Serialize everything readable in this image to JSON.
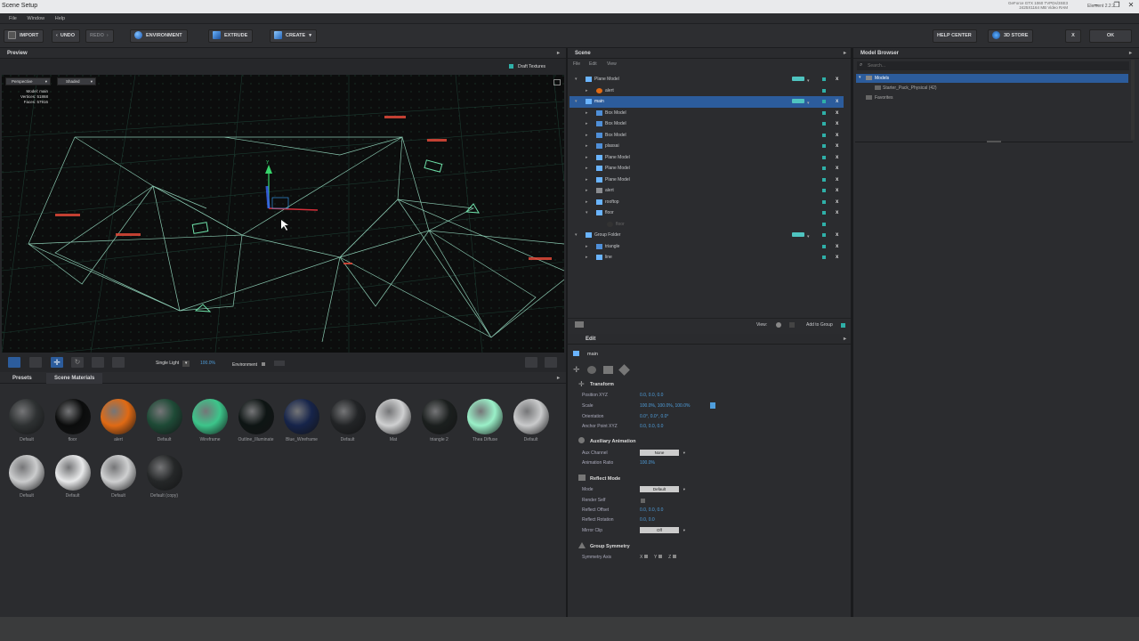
{
  "window": {
    "title": "Scene Setup",
    "gpu_line1": "GeForce GTX 1060 TVPDs/3SE3",
    "gpu_line2": "2425X1164 MB Video RAM",
    "element_label": "Element",
    "element_version": "2.2.2"
  },
  "menu": [
    "File",
    "Window",
    "Help"
  ],
  "toolbar": {
    "import": "IMPORT",
    "undo": "UNDO",
    "redo": "REDO",
    "environment": "ENVIRONMENT",
    "extrude": "EXTRUDE",
    "create": "CREATE",
    "help_center": "HELP CENTER",
    "store": "3D STORE",
    "close": "X",
    "ok": "OK"
  },
  "preview": {
    "title": "Preview",
    "draft_textures": "Draft Textures",
    "camera_mode": "Perspective",
    "shading_mode": "Shaded",
    "stats": [
      {
        "label": "Model:",
        "value": "main"
      },
      {
        "label": "Vertices:",
        "value": "51868"
      },
      {
        "label": "Faces:",
        "value": "57916"
      }
    ],
    "light_mode": "Single Light",
    "zoom": "100.0%",
    "environment_label": "Environment"
  },
  "materials": {
    "tabs": [
      "Presets",
      "Scene Materials"
    ],
    "items": [
      {
        "name": "Default",
        "color": "#2e3132"
      },
      {
        "name": "floor",
        "color": "#0b0c0c"
      },
      {
        "name": "alert",
        "color": "#e06a14"
      },
      {
        "name": "Default",
        "color": "#1e4a36"
      },
      {
        "name": "Wireframe",
        "color": "#3cc58a"
      },
      {
        "name": "Outline_Illuminate",
        "color": "#0e1514"
      },
      {
        "name": "Blue_Wireframe",
        "color": "#16244a"
      },
      {
        "name": "Default",
        "color": "#222426"
      },
      {
        "name": "Mat",
        "color": "#cfd0d1"
      },
      {
        "name": "triangle 2",
        "color": "#1b1f1e"
      },
      {
        "name": "Thea Diffuse",
        "color": "#9af0c8"
      },
      {
        "name": "Default",
        "color": "#c9cacb"
      },
      {
        "name": "Default",
        "color": "#cbcccd"
      },
      {
        "name": "Default",
        "color": "#e8e9ea"
      },
      {
        "name": "Default",
        "color": "#cfd0d1"
      },
      {
        "name": "Default (copy)",
        "color": "#252728"
      }
    ]
  },
  "scene": {
    "title": "Scene",
    "menu": [
      "File",
      "Edit",
      "View"
    ],
    "rows": [
      {
        "label": "Plane Model",
        "depth": 0,
        "type": "mesh",
        "expanded": true,
        "tag": true
      },
      {
        "label": "alert",
        "depth": 1,
        "type": "material",
        "expanded": false,
        "tag": false
      },
      {
        "label": "main",
        "depth": 0,
        "type": "mesh",
        "expanded": true,
        "tag": true,
        "selected": true
      },
      {
        "label": "Box Model",
        "depth": 1,
        "type": "box",
        "expanded": false,
        "tag": false
      },
      {
        "label": "Box Model",
        "depth": 1,
        "type": "box",
        "expanded": false,
        "tag": false
      },
      {
        "label": "Box Model",
        "depth": 1,
        "type": "box",
        "expanded": false,
        "tag": false
      },
      {
        "label": "plassai",
        "depth": 1,
        "type": "box",
        "expanded": false,
        "tag": false
      },
      {
        "label": "Plane Model",
        "depth": 1,
        "type": "mesh",
        "expanded": false,
        "tag": false
      },
      {
        "label": "Plane Model",
        "depth": 1,
        "type": "mesh",
        "expanded": false,
        "tag": false
      },
      {
        "label": "Plane Model",
        "depth": 1,
        "type": "mesh",
        "expanded": false,
        "tag": false
      },
      {
        "label": "alert",
        "depth": 1,
        "type": "folder",
        "expanded": false,
        "tag": false
      },
      {
        "label": "rooftop",
        "depth": 1,
        "type": "mesh",
        "expanded": false,
        "tag": false
      },
      {
        "label": "floor",
        "depth": 1,
        "type": "mesh",
        "expanded": true,
        "tag": false
      },
      {
        "label": "floor",
        "depth": 2,
        "type": "material-dark",
        "expanded": false,
        "tag": false
      },
      {
        "label": "Group Folder",
        "depth": 0,
        "type": "mesh",
        "expanded": true,
        "tag": true
      },
      {
        "label": "triangle",
        "depth": 1,
        "type": "box",
        "expanded": false,
        "tag": false
      },
      {
        "label": "line",
        "depth": 1,
        "type": "mesh",
        "expanded": false,
        "tag": false
      }
    ],
    "footer_view": "View:",
    "add_to_group": "Add to Group"
  },
  "edit": {
    "title": "Edit",
    "object_name": "main",
    "sections": {
      "transform": "Transform",
      "aux_anim": "Auxiliary Animation",
      "reflect": "Reflect Mode",
      "symmetry": "Group Symmetry"
    },
    "props": {
      "position_label": "Position XYZ",
      "position_value": "0.0,   0.0,   0.0",
      "scale_label": "Scale",
      "scale_value": "100.0%,   100.0%,   100.0%",
      "orientation_label": "Orientation",
      "orientation_value": "0.0°,   0.0°,   0.0°",
      "anchor_label": "Anchor Point XYZ",
      "anchor_value": "0.0,   0.0,   0.0",
      "aux_channel_label": "Aux Channel",
      "aux_channel_value": "None",
      "anim_ratio_label": "Animation Ratio",
      "anim_ratio_value": "100.0%",
      "mode_label": "Mode",
      "mode_value": "Default",
      "render_self_label": "Render Self",
      "reflect_offset_label": "Reflect Offset",
      "reflect_offset_value": "0.0,   0.0,   0.0",
      "reflect_rotation_label": "Reflect Rotation",
      "reflect_rotation_value": "0.0,   0.0",
      "mirror_clip_label": "Mirror Clip",
      "mirror_clip_value": "Off",
      "sym_axis_label": "Symmetry Axis",
      "axes": [
        "X",
        "Y",
        "Z"
      ]
    }
  },
  "browser": {
    "title": "Model Browser",
    "search_placeholder": "Search...",
    "tree": [
      {
        "label": "Models",
        "depth": 0,
        "selected": true
      },
      {
        "label": "Starter_Pack_Physical (42)",
        "depth": 1,
        "selected": false
      },
      {
        "label": "Favorites",
        "depth": 0,
        "selected": false
      }
    ]
  },
  "colors": {
    "accent_blue": "#2c5c9c",
    "teal": "#2fb0a8",
    "wire_green": "#9fe8cc",
    "alert_orange": "#e06a14"
  }
}
